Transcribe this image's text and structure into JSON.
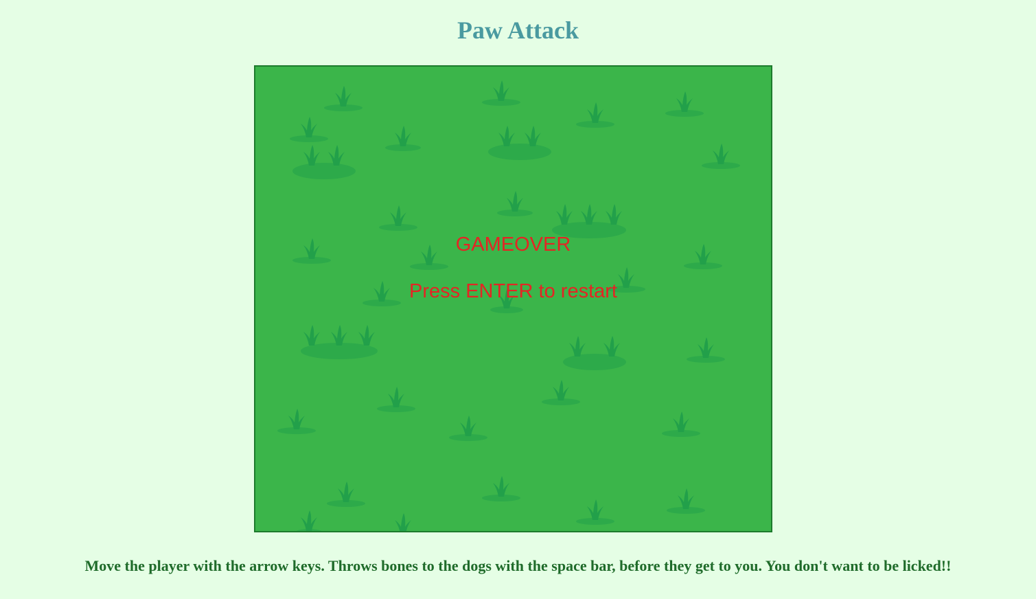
{
  "page": {
    "title": "Paw Attack",
    "instructions": "Move the player with the arrow keys. Throws bones to the dogs with the space bar, before they get to you. You don't want to be licked!!"
  },
  "game": {
    "status_text": "GAMEOVER",
    "restart_prompt": "Press ENTER to restart",
    "background_icon": "grass-tuft-icon"
  },
  "colors": {
    "page_background": "#e5fee5",
    "title": "#4a9aa0",
    "field_grass": "#3bb54a",
    "grass_tuft": "#22a04a",
    "field_border": "#1c7a2c",
    "overlay_text": "#e52424",
    "instructions_text": "#1f6b2a"
  }
}
